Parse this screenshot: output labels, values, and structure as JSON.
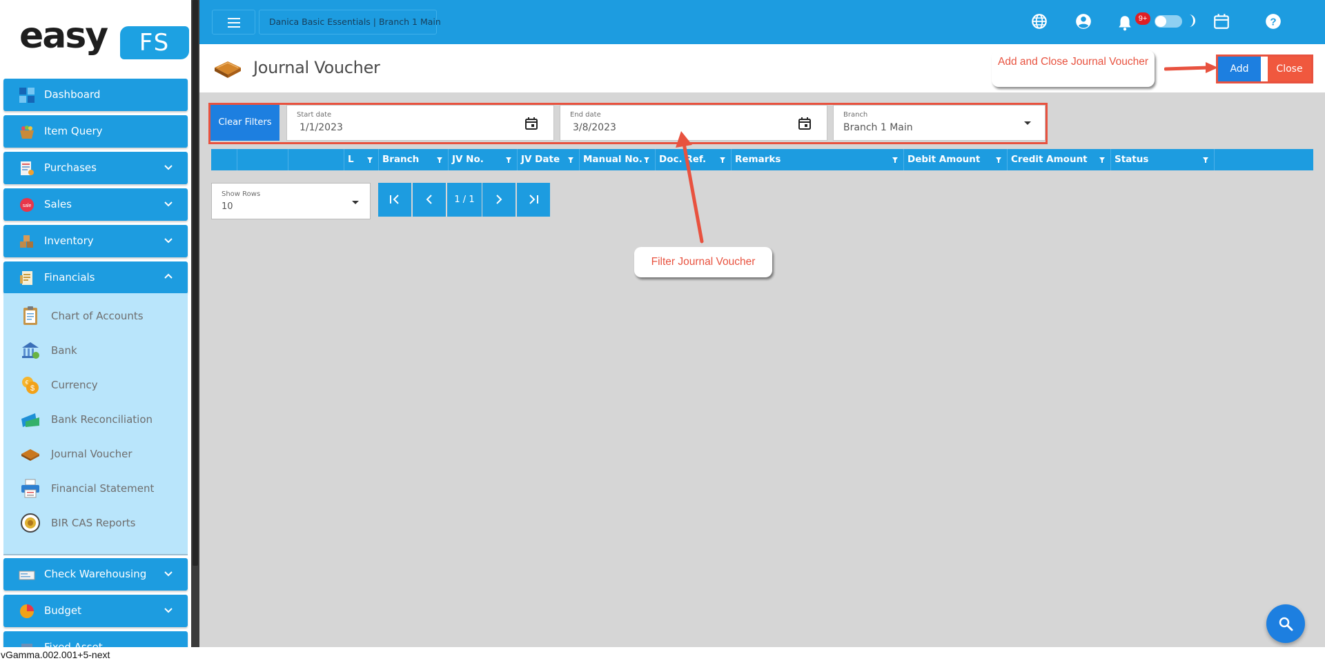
{
  "app": {
    "logo_main": "easy",
    "logo_accent": "FS",
    "company_branch": "Danica Basic Essentials | Branch 1 Main",
    "notification_count": "9+",
    "version": "vGamma.002.001+5-next"
  },
  "sidebar": {
    "items": [
      {
        "label": "Dashboard"
      },
      {
        "label": "Item Query"
      },
      {
        "label": "Purchases"
      },
      {
        "label": "Sales"
      },
      {
        "label": "Inventory"
      },
      {
        "label": "Financials"
      },
      {
        "label": "Check Warehousing"
      },
      {
        "label": "Budget"
      },
      {
        "label": "Fixed Asset"
      }
    ],
    "financials_sub": [
      {
        "label": "Chart of Accounts"
      },
      {
        "label": "Bank"
      },
      {
        "label": "Currency"
      },
      {
        "label": "Bank Reconciliation"
      },
      {
        "label": "Journal Voucher"
      },
      {
        "label": "Financial Statement"
      },
      {
        "label": "BIR CAS Reports"
      }
    ]
  },
  "page": {
    "title": "Journal Voucher",
    "add_label": "Add",
    "close_label": "Close"
  },
  "filters": {
    "clear_label": "Clear Filters",
    "start_label": "Start date",
    "start_value": "1/1/2023",
    "end_label": "End date",
    "end_value": "3/8/2023",
    "branch_label": "Branch",
    "branch_value": "Branch 1 Main"
  },
  "grid": {
    "columns": [
      "L",
      "Branch",
      "JV No.",
      "JV Date",
      "Manual No.",
      "Doc. Ref.",
      "Remarks",
      "Debit Amount",
      "Credit Amount",
      "Status"
    ]
  },
  "pagination": {
    "rows_label": "Show Rows",
    "rows_value": "10",
    "page_label": "1 / 1"
  },
  "annotations": {
    "add_close": "Add and Close Journal Voucher",
    "filter": "Filter Journal Voucher"
  },
  "colors": {
    "primary": "#1d9ce0",
    "button_blue": "#1d7fe0",
    "close_red": "#f0583e",
    "annotation_red": "#e8523f",
    "submenu_bg": "#b9e5fb"
  }
}
